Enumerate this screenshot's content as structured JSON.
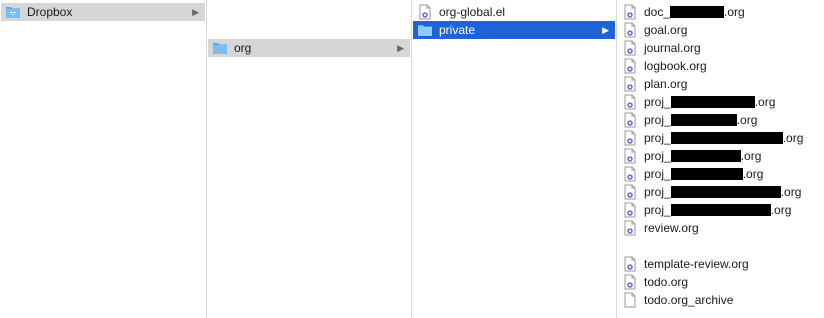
{
  "columns": [
    {
      "items": [
        {
          "label": "Dropbox",
          "icon": "dropbox-folder-icon",
          "selected": "gray",
          "expandable": true
        }
      ]
    },
    {
      "items": [
        {
          "label": "org",
          "icon": "folder-icon",
          "selected": "gray",
          "expandable": true
        }
      ]
    },
    {
      "items": [
        {
          "label": "org-global.el",
          "icon": "org-file-icon"
        },
        {
          "label": "private",
          "icon": "folder-icon",
          "selected": "blue",
          "expandable": true
        }
      ]
    },
    {
      "items": [
        {
          "prefix": "doc_",
          "suffix": ".org",
          "redacted": true
        },
        {
          "label": "goal.org"
        },
        {
          "label": "journal.org"
        },
        {
          "label": "logbook.org"
        },
        {
          "label": "plan.org"
        },
        {
          "prefix": "proj_",
          "suffix": ".org",
          "redacted": true
        },
        {
          "prefix": "proj_",
          "suffix": ".org",
          "redacted": true
        },
        {
          "prefix": "proj_",
          "suffix": ".org",
          "redacted": true
        },
        {
          "prefix": "proj_",
          "suffix": ".org",
          "redacted": true
        },
        {
          "prefix": "proj_",
          "suffix": ".org",
          "redacted": true
        },
        {
          "prefix": "proj_",
          "suffix": ".org",
          "redacted": true
        },
        {
          "prefix": "proj_",
          "suffix": ".org",
          "redacted": true
        },
        {
          "label": "review.org"
        },
        {
          "label": "template-review.org"
        },
        {
          "label": "todo.org"
        },
        {
          "label": "todo.org_archive",
          "icon": "blank-file-icon"
        }
      ]
    }
  ],
  "colors": {
    "selection_blue": "#1c64d8",
    "selection_gray": "#d6d6d6",
    "folder_blue": "#5aa7e8"
  }
}
